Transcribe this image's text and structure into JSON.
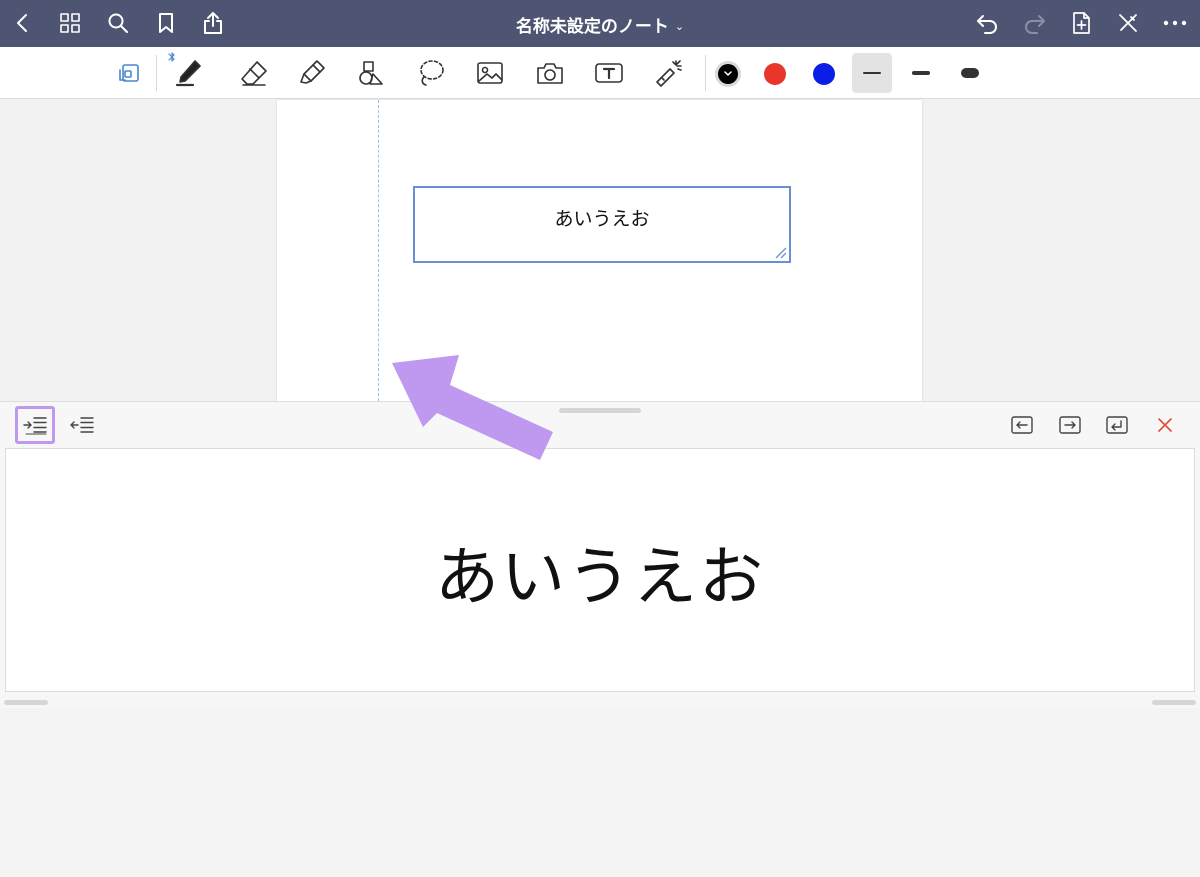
{
  "header": {
    "title": "名称未設定のノート",
    "title_chevron": "⌄",
    "background": "#4e5573"
  },
  "toolbar": {
    "tools": [
      "page-layout",
      "pen",
      "eraser",
      "highlighter",
      "shapes",
      "lasso",
      "image",
      "camera",
      "text",
      "laser-pointer"
    ],
    "colors": [
      "#000000",
      "#e8372a",
      "#0a1ee6"
    ],
    "selected_color": "#000000",
    "stroke_widths": [
      "thin",
      "medium",
      "thick"
    ],
    "selected_stroke": "thin"
  },
  "canvas": {
    "textbox_text": "あいうえお",
    "textbox_border": "#6a8fd1"
  },
  "annotation": {
    "arrow_color": "#bf98ef"
  },
  "editor_panel": {
    "left_tools": [
      "indent-right",
      "indent-left"
    ],
    "active_tool": "indent-right",
    "right_tools": [
      "move-left",
      "move-right",
      "return",
      "close"
    ],
    "editor_text": "あいうえお",
    "close_color": "#e04b3a"
  }
}
